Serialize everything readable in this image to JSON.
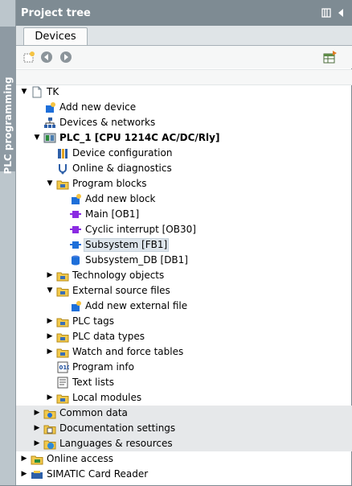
{
  "sidebar": {
    "tab_label": "PLC programming"
  },
  "header": {
    "title": "Project tree"
  },
  "tabs": [
    {
      "label": "Devices"
    }
  ],
  "tree": [
    {
      "label": "TK",
      "icon": "document-icon",
      "arrow": "down",
      "level": 0
    },
    {
      "label": "Add new device",
      "icon": "add-device-icon",
      "arrow": "",
      "level": 1
    },
    {
      "label": "Devices & networks",
      "icon": "network-icon",
      "arrow": "",
      "level": 1
    },
    {
      "label": "PLC_1 [CPU 1214C AC/DC/Rly]",
      "icon": "plc-icon",
      "arrow": "down",
      "level": 1,
      "bold": true
    },
    {
      "label": "Device configuration",
      "icon": "device-config-icon",
      "arrow": "",
      "level": 2
    },
    {
      "label": "Online & diagnostics",
      "icon": "diagnostics-icon",
      "arrow": "",
      "level": 2
    },
    {
      "label": "Program blocks",
      "icon": "folder-icon",
      "arrow": "down",
      "level": 2
    },
    {
      "label": "Add new block",
      "icon": "add-block-icon",
      "arrow": "",
      "level": 3
    },
    {
      "label": "Main [OB1]",
      "icon": "ob-block-icon",
      "arrow": "",
      "level": 3
    },
    {
      "label": "Cyclic interrupt [OB30]",
      "icon": "ob-block-icon",
      "arrow": "",
      "level": 3
    },
    {
      "label": "Subsystem [FB1]",
      "icon": "fb-block-icon",
      "arrow": "",
      "level": 3,
      "selected": true
    },
    {
      "label": "Subsystem_DB [DB1]",
      "icon": "db-block-icon",
      "arrow": "",
      "level": 3
    },
    {
      "label": "Technology objects",
      "icon": "folder-icon",
      "arrow": "right",
      "level": 2
    },
    {
      "label": "External source files",
      "icon": "folder-icon",
      "arrow": "down",
      "level": 2
    },
    {
      "label": "Add new external file",
      "icon": "add-file-icon",
      "arrow": "",
      "level": 3
    },
    {
      "label": "PLC tags",
      "icon": "folder-icon",
      "arrow": "right",
      "level": 2
    },
    {
      "label": "PLC data types",
      "icon": "folder-icon",
      "arrow": "right",
      "level": 2
    },
    {
      "label": "Watch and force tables",
      "icon": "folder-icon",
      "arrow": "right",
      "level": 2
    },
    {
      "label": "Program info",
      "icon": "program-info-icon",
      "arrow": "",
      "level": 2
    },
    {
      "label": "Text lists",
      "icon": "text-list-icon",
      "arrow": "",
      "level": 2
    },
    {
      "label": "Local modules",
      "icon": "folder-icon",
      "arrow": "right",
      "level": 2
    },
    {
      "label": "Common data",
      "icon": "common-data-icon",
      "arrow": "right",
      "level": 1,
      "grey": true
    },
    {
      "label": "Documentation settings",
      "icon": "documentation-icon",
      "arrow": "right",
      "level": 1,
      "grey": true
    },
    {
      "label": "Languages & resources",
      "icon": "languages-icon",
      "arrow": "right",
      "level": 1,
      "grey": true
    },
    {
      "label": "Online access",
      "icon": "online-access-icon",
      "arrow": "right",
      "level": 0
    },
    {
      "label": "SIMATIC Card Reader",
      "icon": "card-reader-icon",
      "arrow": "right",
      "level": 0
    }
  ],
  "colors": {
    "header_bg": "#7e8b93",
    "sidebar_tab": "#8e9aa3",
    "folder": "#f2c94c",
    "block_purple": "#8a2be2",
    "block_blue": "#1e6fd9"
  }
}
